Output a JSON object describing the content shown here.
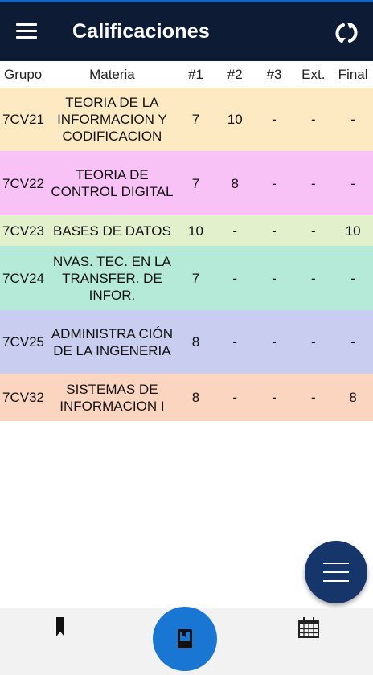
{
  "app": {
    "title": "Calificaciones",
    "bar_color": "#0d1b35",
    "accent": "#1976d2"
  },
  "icons": {
    "menu": "menu-icon",
    "refresh": "refresh-icon",
    "fab_menu": "menu-lines-icon",
    "bookmark": "bookmark-icon",
    "book": "book-icon",
    "calendar": "calendar-icon"
  },
  "table": {
    "headers": {
      "grupo": "Grupo",
      "materia": "Materia",
      "p1": "#1",
      "p2": "#2",
      "p3": "#3",
      "ext": "Ext.",
      "final": "Final"
    },
    "rows": [
      {
        "grupo": "7CV21",
        "materia": "TEORIA DE LA INFORMACION Y CODIFICACION",
        "p1": "7",
        "p2": "10",
        "p3": "-",
        "ext": "-",
        "final": "-",
        "color": "#fde9c2"
      },
      {
        "grupo": "7CV22",
        "materia": "TEORIA DE CONTROL DIGITAL",
        "p1": "7",
        "p2": "8",
        "p3": "-",
        "ext": "-",
        "final": "-",
        "color": "#f9c2f7"
      },
      {
        "grupo": "7CV23",
        "materia": "BASES DE DATOS",
        "p1": "10",
        "p2": "-",
        "p3": "-",
        "ext": "-",
        "final": "10",
        "color": "#e2f0cb"
      },
      {
        "grupo": "7CV24",
        "materia": "NVAS. TEC. EN LA TRANSFER. DE INFOR.",
        "p1": "7",
        "p2": "-",
        "p3": "-",
        "ext": "-",
        "final": "-",
        "color": "#b6ead8"
      },
      {
        "grupo": "7CV25",
        "materia": "ADMINISTRA CIÓN DE LA INGENERIA",
        "p1": "8",
        "p2": "-",
        "p3": "-",
        "ext": "-",
        "final": "-",
        "color": "#c9cdef"
      },
      {
        "grupo": "7CV32",
        "materia": "SISTEMAS DE INFORMACION I",
        "p1": "8",
        "p2": "-",
        "p3": "-",
        "ext": "-",
        "final": "8",
        "color": "#fbd5bf"
      }
    ]
  }
}
